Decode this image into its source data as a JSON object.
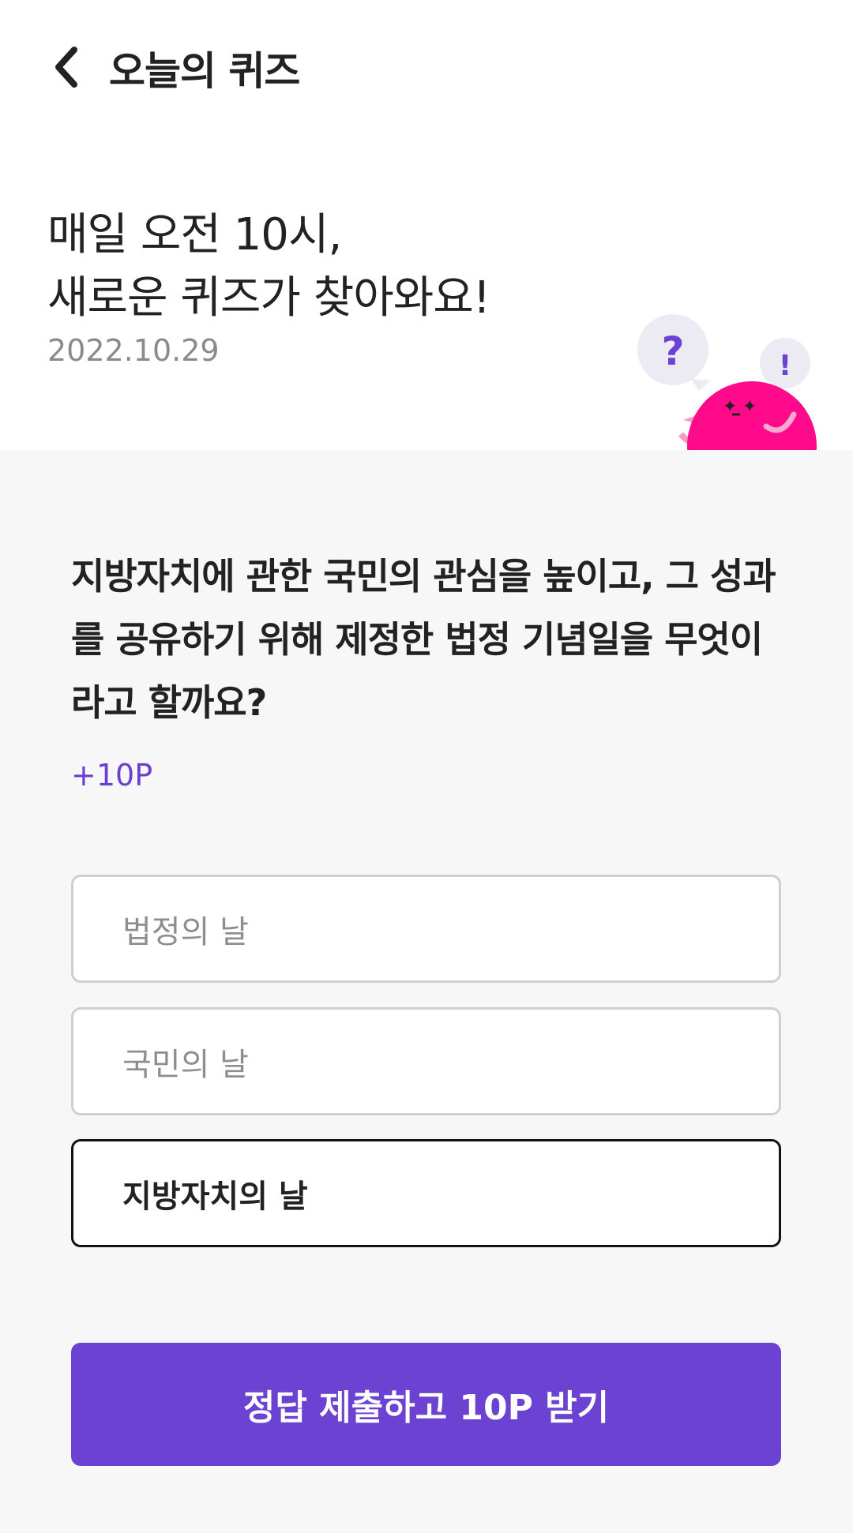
{
  "header": {
    "title": "오늘의 퀴즈",
    "back_icon": "chevron-left-icon"
  },
  "hero": {
    "line1": "매일 오전 10시,",
    "line2": "새로운 퀴즈가 찾아와요!",
    "date": "2022.10.29",
    "bubble_question": "?",
    "bubble_exclaim": "!"
  },
  "quiz": {
    "question": "지방자치에 관한 국민의 관심을 높이고, 그 성과를 공유하기 위해 제정한 법정 기념일을 무엇이라고 할까요?",
    "points": "+10P",
    "options": [
      {
        "label": "법정의 날",
        "selected": false
      },
      {
        "label": "국민의 날",
        "selected": false
      },
      {
        "label": "지방자치의 날",
        "selected": true
      }
    ],
    "submit_label": "정답 제출하고 10P 받기"
  },
  "colors": {
    "accent": "#6b42d1",
    "background": "#f7f7f7",
    "mascot": "#ff0a8a"
  }
}
